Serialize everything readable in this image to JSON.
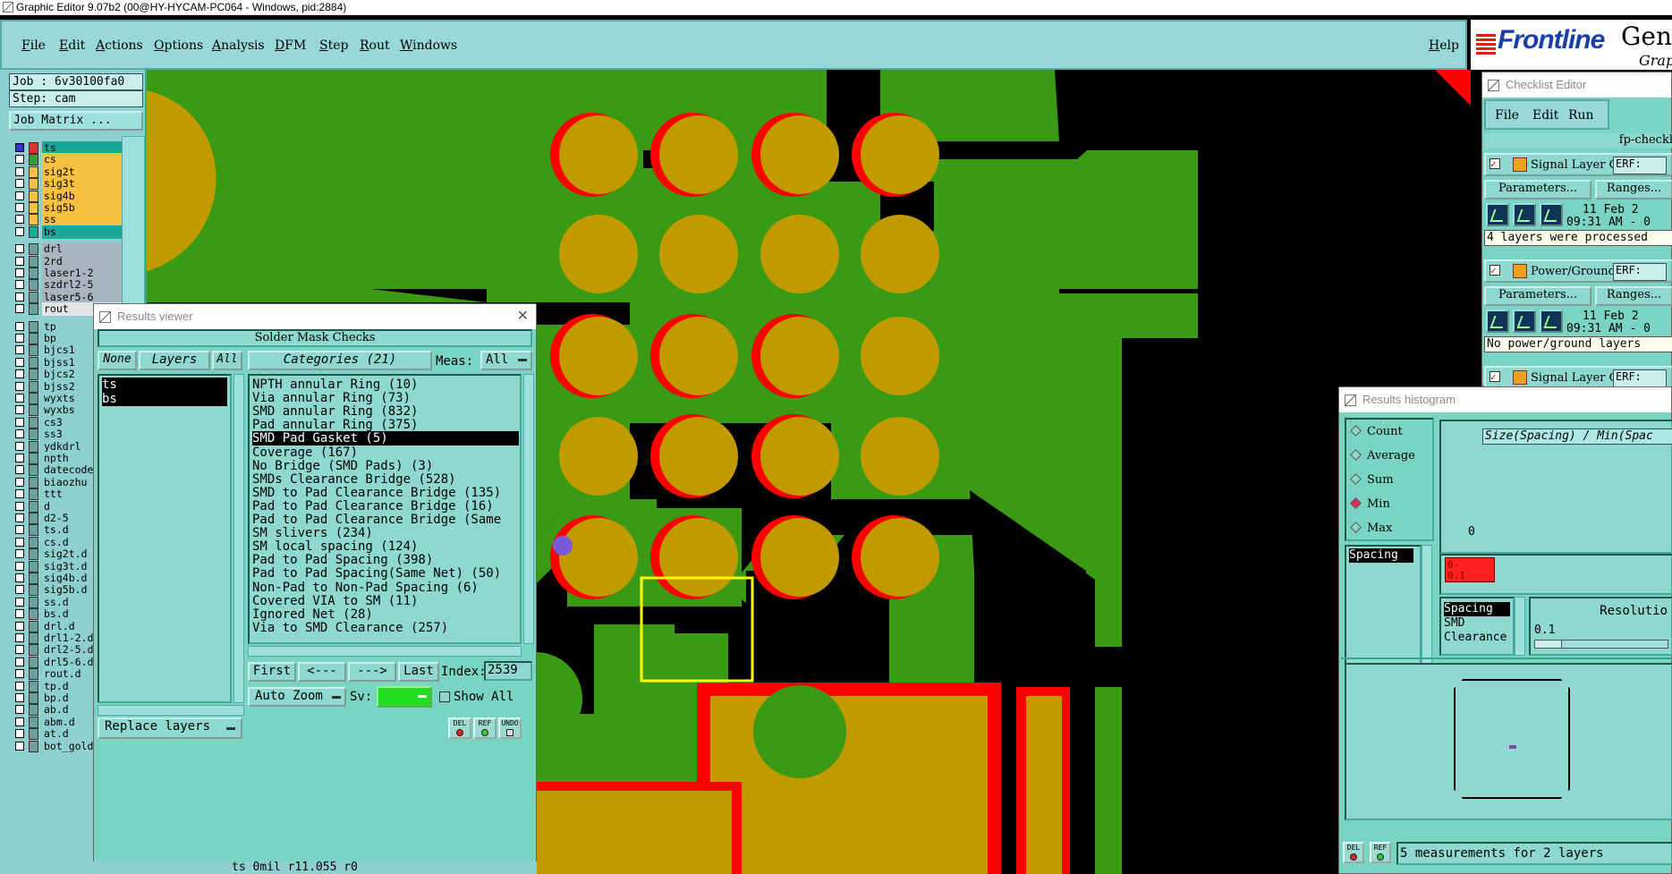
{
  "titlebar": {
    "text": "Graphic Editor 9.07b2 (00@HY-HYCAM-PC064 - Windows, pid:2884)"
  },
  "menu": {
    "items": [
      "File",
      "Edit",
      "Actions",
      "Options",
      "Analysis",
      "DFM",
      "Step",
      "Rout",
      "Windows"
    ],
    "help": "Help"
  },
  "logo": {
    "brand": "Frontline",
    "gen": "Gene",
    "grp": "Graph"
  },
  "left": {
    "job": "Job : 6v30100fa0",
    "step": "Step: cam",
    "job_matrix": "Job Matrix ...",
    "group1": [
      {
        "name": "ts",
        "color": "#1aa898",
        "swatch": "#e03030",
        "checked": true
      },
      {
        "name": "cs",
        "color": "#f8c040",
        "swatch": "#30a030",
        "checked": false
      },
      {
        "name": "sig2t",
        "color": "#f8c040",
        "swatch": "#f8c040",
        "checked": false
      },
      {
        "name": "sig3t",
        "color": "#f8c040",
        "swatch": "#f8c040",
        "checked": false
      },
      {
        "name": "sig4b",
        "color": "#f8c040",
        "swatch": "#f8c040",
        "checked": false
      },
      {
        "name": "sig5b",
        "color": "#f8c040",
        "swatch": "#f8c040",
        "checked": false
      },
      {
        "name": "ss",
        "color": "#f8c040",
        "swatch": "#f8c040",
        "checked": false
      },
      {
        "name": "bs",
        "color": "#1aa898",
        "swatch": "#1aa898",
        "checked": false
      }
    ],
    "group2": [
      {
        "name": "drl",
        "color": "#a8b4c0"
      },
      {
        "name": "2rd",
        "color": "#a8b4c0"
      },
      {
        "name": "laser1-2",
        "color": "#a8b4c0"
      },
      {
        "name": "szdrl2-5",
        "color": "#a8b4c0"
      },
      {
        "name": "laser5-6",
        "color": "#a8b4c0"
      },
      {
        "name": "rout",
        "color": "#e4e4e4"
      }
    ],
    "group3": [
      "tp",
      "bp",
      "bjcs1",
      "bjss1",
      "bjcs2",
      "bjss2",
      "wyxts",
      "wyxbs",
      "cs3",
      "ss3",
      "ydkdrl",
      "npth",
      "datecode",
      "biaozhu",
      "ttt",
      "d",
      "d2-5",
      "ts.d",
      "cs.d",
      "sig2t.d",
      "sig3t.d",
      "sig4b.d",
      "sig5b.d",
      "ss.d",
      "bs.d",
      "drl.d",
      "drl1-2.d",
      "drl2-5.d",
      "drl5-6.d",
      "rout.d",
      "tp.d",
      "bp.d",
      "ab.d",
      "abm.d",
      "at.d",
      "bot_gold"
    ]
  },
  "results_viewer": {
    "title": "Results viewer",
    "header": "Solder Mask Checks",
    "none": "None",
    "layers": "Layers",
    "all": "All",
    "categories_label": "Categories (21)",
    "meas_label": "Meas:",
    "meas_value": "All",
    "layer_list": [
      "ts",
      "bs"
    ],
    "categories": [
      "NPTH annular Ring (10)",
      "Via annular Ring (73)",
      "SMD annular Ring (832)",
      "Pad annular Ring (375)",
      "SMD Pad Gasket (5)",
      "Coverage (167)",
      "No Bridge (SMD Pads) (3)",
      "SMDs Clearance Bridge (528)",
      "SMD to Pad Clearance Bridge (135)",
      "Pad to Pad Clearance Bridge (16)",
      "Pad to Pad Clearance Bridge (Same",
      "SM slivers (234)",
      "SM local spacing (124)",
      "Pad to Pad Spacing (398)",
      "Pad to Pad Spacing(Same Net) (50)",
      "Non-Pad to Non-Pad Spacing (6)",
      "Covered VIA to SM (11)",
      "Ignored Net (28)",
      "Via to SMD Clearance (257)"
    ],
    "selected_category": 4,
    "first": "First",
    "prev": "<---",
    "next": "--->",
    "last": "Last",
    "index_label": "Index:",
    "index_value": "2539",
    "auto_zoom": "Auto Zoom",
    "sv_label": "Sv:",
    "show_all": "Show All",
    "replace_layers": "Replace layers",
    "del": "DEL",
    "ref": "REF",
    "undo": "UNDO"
  },
  "checklist": {
    "title": "Checklist Editor",
    "menu": [
      "File",
      "Edit",
      "Run"
    ],
    "name": "fp-checkl",
    "items": [
      {
        "label": "Signal Layer Ch",
        "erf": "ERF:",
        "params": "Parameters...",
        "ranges": "Ranges...",
        "date": "11 Feb 2",
        "time": "09:31 AM - 0",
        "status": "4 layers were processed"
      },
      {
        "label": "Power/Ground C",
        "erf": "ERF:",
        "params": "Parameters...",
        "ranges": "Ranges...",
        "date": "11 Feb 2",
        "time": "09:31 AM - 0",
        "status": "No power/ground layers"
      },
      {
        "label": "Signal Layer Ch",
        "erf": "ERF:"
      }
    ]
  },
  "histogram": {
    "title": "Results histogram",
    "options": [
      "Count",
      "Average",
      "Sum",
      "Min",
      "Max"
    ],
    "selected_option": "Min",
    "list_item": "Spacing",
    "chart_title": "Size(Spacing) / Min(Spac",
    "zero_label": "0",
    "bin_label": "0-\n0.1",
    "metric_list": [
      "Spacing",
      "SMD",
      "Clearance"
    ],
    "resolution_label": "Resolutio",
    "resolution_value": "0.1",
    "status": "5 measurements for 2 layers",
    "del": "DEL",
    "ref": "REF"
  },
  "statusline": {
    "text": "ts 0mil  r11.055  r0"
  },
  "colors": {
    "board_green": "#3a9a14",
    "pad": "#c19a00",
    "mask": "#ff0000",
    "window_teal": "#7ad4c4",
    "highlight": "#ffff00"
  }
}
